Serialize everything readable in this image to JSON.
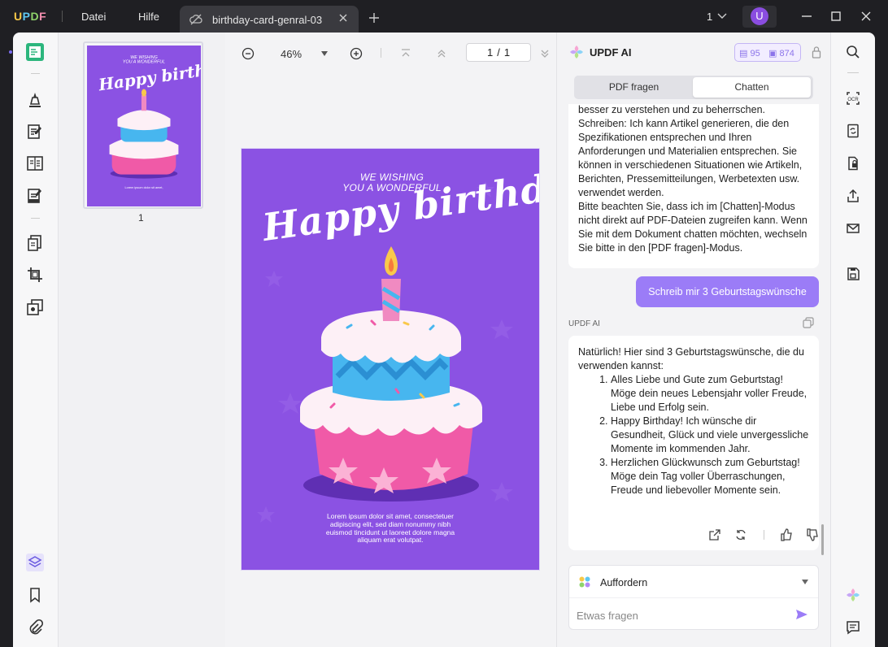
{
  "app": {
    "logo": [
      "U",
      "P",
      "D",
      "F"
    ],
    "menu": [
      "Datei",
      "Hilfe"
    ],
    "tab_title": "birthday-card-genral-03",
    "page_count": "1",
    "avatar_initial": "U"
  },
  "viewer": {
    "zoom": "46%",
    "current_page": "1",
    "total_pages": "1",
    "thumbnail_label": "1"
  },
  "card": {
    "wish_line1": "WE WISHING",
    "wish_line2": "YOU A WONDERFUL",
    "headline": "Happy birthday",
    "lorem": "Lorem ipsum dolor sit amet, consectetuer adipiscing elit, sed diam nonummy nibh euismod tincidunt ut laoreet dolore magna aliquam erat volutpat.",
    "background_color": "#8b52e3"
  },
  "ai": {
    "title": "UPDF AI",
    "credits_pdf": "95",
    "credits_chat": "874",
    "mode_tabs": [
      "PDF fragen",
      "Chatten"
    ],
    "active_mode": "Chatten",
    "previous_message": [
      "besser zu verstehen und zu beherrschen.",
      "Schreiben: Ich kann Artikel generieren, die den Spezifikationen entsprechen und Ihren Anforderungen und Materialien entsprechen. Sie können in verschiedenen Situationen wie Artikeln, Berichten, Pressemitteilungen, Werbetexten usw. verwendet werden.",
      "Bitte beachten Sie, dass ich im [Chatten]-Modus nicht direkt auf PDF-Dateien zugreifen kann. Wenn Sie mit dem Dokument chatten möchten, wechseln Sie bitte in den [PDF fragen]-Modus."
    ],
    "user_message": "Schreib mir 3 Geburtstagswünsche",
    "assistant_label": "UPDF AI",
    "answer_intro": "Natürlich! Hier sind 3 Geburtstagswünsche, die du verwenden kannst:",
    "answer_items": [
      "Alles Liebe und Gute zum Geburtstag! Möge dein neues Lebensjahr voller Freude, Liebe und Erfolg sein.",
      "Happy Birthday! Ich wünsche dir Gesundheit, Glück und viele unvergessliche Momente im kommenden Jahr.",
      "Herzlichen Glückwunsch zum Geburtstag! Möge dein Tag voller Überraschungen, Freude und liebevoller Momente sein."
    ],
    "prompt_label": "Auffordern",
    "ask_placeholder": "Etwas fragen",
    "accent_color": "#9b7cf7"
  }
}
